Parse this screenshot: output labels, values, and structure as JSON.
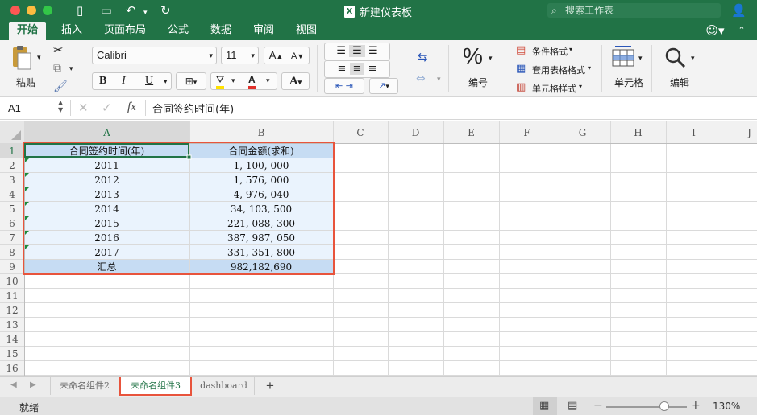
{
  "window": {
    "title": "新建仪表板",
    "search_placeholder": "搜索工作表"
  },
  "ribbon_tabs": [
    "开始",
    "插入",
    "页面布局",
    "公式",
    "数据",
    "审阅",
    "视图"
  ],
  "ribbon": {
    "paste_label": "粘贴",
    "font_name": "Calibri",
    "font_size": "11",
    "number_label": "编号",
    "conditional_format": "条件格式",
    "table_format": "套用表格格式",
    "cell_style": "单元格样式",
    "cells_label": "单元格",
    "edit_label": "编辑",
    "bold": "B",
    "italic": "I",
    "underline": "U",
    "grow_font": "A",
    "shrink_font": "A",
    "font_color_glyph": "A",
    "percent": "%"
  },
  "formula_bar": {
    "cell_ref": "A1",
    "fx": "fx",
    "content": "合同签约时间(年)"
  },
  "grid": {
    "columns": [
      "A",
      "B",
      "C",
      "D",
      "E",
      "F",
      "G",
      "H",
      "I",
      "J"
    ],
    "rows": [
      "1",
      "2",
      "3",
      "4",
      "5",
      "6",
      "7",
      "8",
      "9",
      "10",
      "11",
      "12",
      "13",
      "14",
      "15",
      "16"
    ],
    "table": {
      "header": [
        "合同签约时间(年)",
        "合同金额(求和)"
      ],
      "rows": [
        [
          "2011",
          "1, 100, 000"
        ],
        [
          "2012",
          "1, 576, 000"
        ],
        [
          "2013",
          "4, 976, 040"
        ],
        [
          "2014",
          "34, 103, 500"
        ],
        [
          "2015",
          "221, 088, 300"
        ],
        [
          "2016",
          "387, 987, 050"
        ],
        [
          "2017",
          "331, 351, 800"
        ]
      ],
      "total": [
        "汇总",
        "982,182,690"
      ]
    }
  },
  "sheet_tabs": [
    "未命名组件2",
    "未命名组件3",
    "dashboard"
  ],
  "add_sheet": "+",
  "status": {
    "ready": "就绪",
    "zoom": "130%",
    "zoom_fraction": 0.72,
    "minus": "−",
    "plus": "+"
  },
  "colors": {
    "brand": "#217346",
    "table_header": "#c6dcf3",
    "table_row": "#eaf3fd",
    "highlight_border": "#e8543c"
  }
}
